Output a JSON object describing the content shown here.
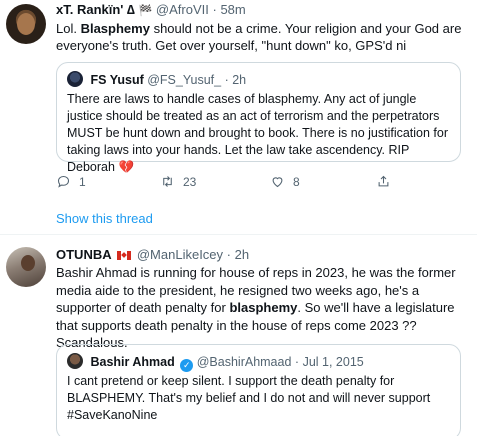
{
  "tweet1": {
    "name": "xT. Rankïn' ∆",
    "name_flag": "🏁",
    "handle": "@AfroVII",
    "sep": "·",
    "time": "58m",
    "text_pre": "Lol. ",
    "text_bold": "Blasphemy",
    "text_post": " should not be a crime. Your religion and your God are everyone's truth. Get over yourself, \"hunt down\" ko, GPS'd ni",
    "quote": {
      "name": "FS Yusuf",
      "handle": "@FS_Yusuf_",
      "sep": "·",
      "time": "2h",
      "text": "There are laws to handle cases of blasphemy. Any act of jungle justice should be treated as an act of terrorism and the perpetrators MUST be hunt down and brought to book. There is no justification for taking laws into your hands. Let the law take ascendency. RIP Deborah ",
      "emoji": "💔"
    },
    "actions": {
      "replies": "1",
      "retweets": "23",
      "likes": "8"
    },
    "show_thread": "Show this thread"
  },
  "tweet2": {
    "name": "OTUNBA",
    "handle": "@ManLikeIcey",
    "sep": "·",
    "time": "2h",
    "text_pre": "Bashir Ahmad is running for house of reps in 2023, he was the former media aide to the president, he resigned two weeks ago, he's a supporter of death penalty for ",
    "text_bold": "blasphemy",
    "text_post": ". So we'll have a legislature that supports death penalty in the house of reps come 2023 ?? Scandalous.",
    "quote": {
      "name": "Bashir Ahmad",
      "handle": "@BashirAhmaad",
      "sep": "·",
      "date": "Jul 1, 2015",
      "text": "I cant pretend or keep silent. I support the death penalty for BLASPHEMY. That's my belief and I do not and will never support #SaveKanoNine"
    }
  },
  "colors": {
    "link": "#1d9bf0",
    "muted": "#536471",
    "border": "#cfd9de",
    "heart": "#e0245e"
  },
  "icons": [
    "reply-icon",
    "retweet-icon",
    "like-icon",
    "share-icon",
    "verified-badge-icon",
    "canada-flag-icon"
  ]
}
